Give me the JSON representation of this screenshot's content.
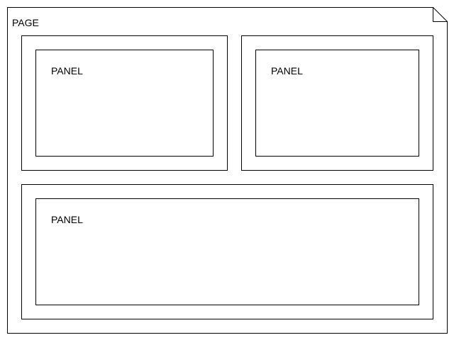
{
  "page": {
    "label": "PAGE"
  },
  "panels": [
    {
      "label": "PANEL"
    },
    {
      "label": "PANEL"
    },
    {
      "label": "PANEL"
    }
  ]
}
